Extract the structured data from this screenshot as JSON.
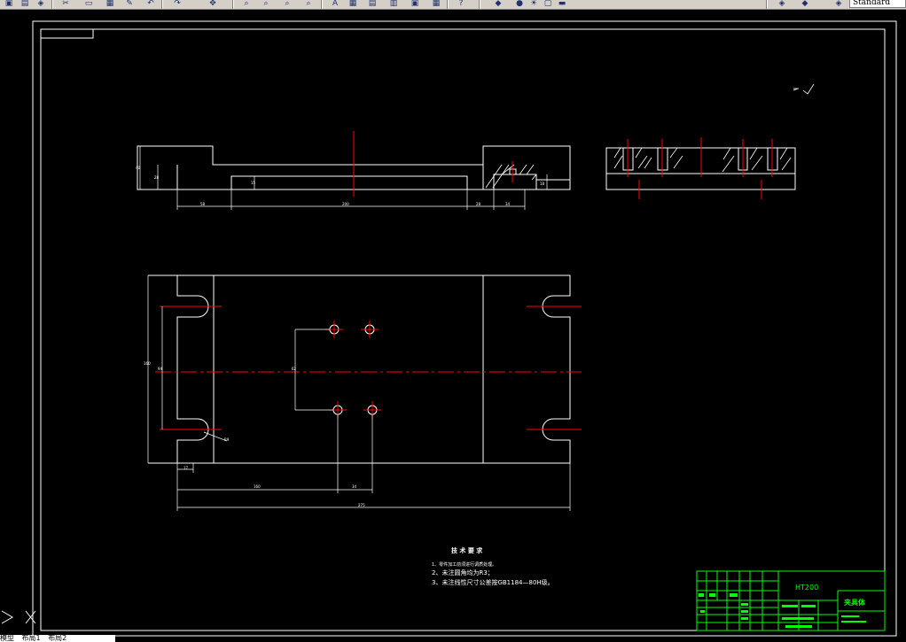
{
  "toolbar": {
    "style_value": "Standard",
    "icons": [
      "open-icon",
      "save-icon",
      "print-icon",
      "cut-icon",
      "copy-icon",
      "paste-icon",
      "match-icon",
      "undo-icon",
      "redo-icon",
      "pan-icon",
      "zoom-icon",
      "zoom-window-icon",
      "zoom-previous-icon",
      "text-icon",
      "properties-icon",
      "design-center-icon",
      "tool-palette-icon",
      "calculator-icon",
      "help-icon",
      "layer-icon",
      "color-icon",
      "lineweight-icon",
      "style-icon",
      "dimstyle-icon",
      "plot-icon"
    ]
  },
  "drawing": {
    "dims": {
      "side_height": "40",
      "side_inner": "28",
      "slot_depth": "15",
      "slot_small": "18",
      "side_left": "58",
      "side_main": "200",
      "side_small": "28",
      "side_right": "34",
      "plan_height": "160",
      "plan_inner": "94",
      "hole_spacing": "62",
      "radius": "R9",
      "left_offset": "17",
      "hole_x": "160",
      "hole_gap": "34",
      "overall_width": "275"
    },
    "tech_notes": {
      "heading": "技 术 要 求",
      "line1": "1、零件加工前须进行调质处理。",
      "line2": "2、未注圆角均为R3；",
      "line3": "3、未注线性尺寸公差按GB1184—80H级。"
    },
    "title_block": {
      "material": "HT200",
      "part_name": "夹具体"
    }
  },
  "status": {
    "items": [
      "模型",
      "布局1",
      "布局2"
    ]
  },
  "colors": {
    "background": "#000000",
    "geometry": "#ffffff",
    "centerline": "#ff0000",
    "title_block": "#00ff00"
  }
}
